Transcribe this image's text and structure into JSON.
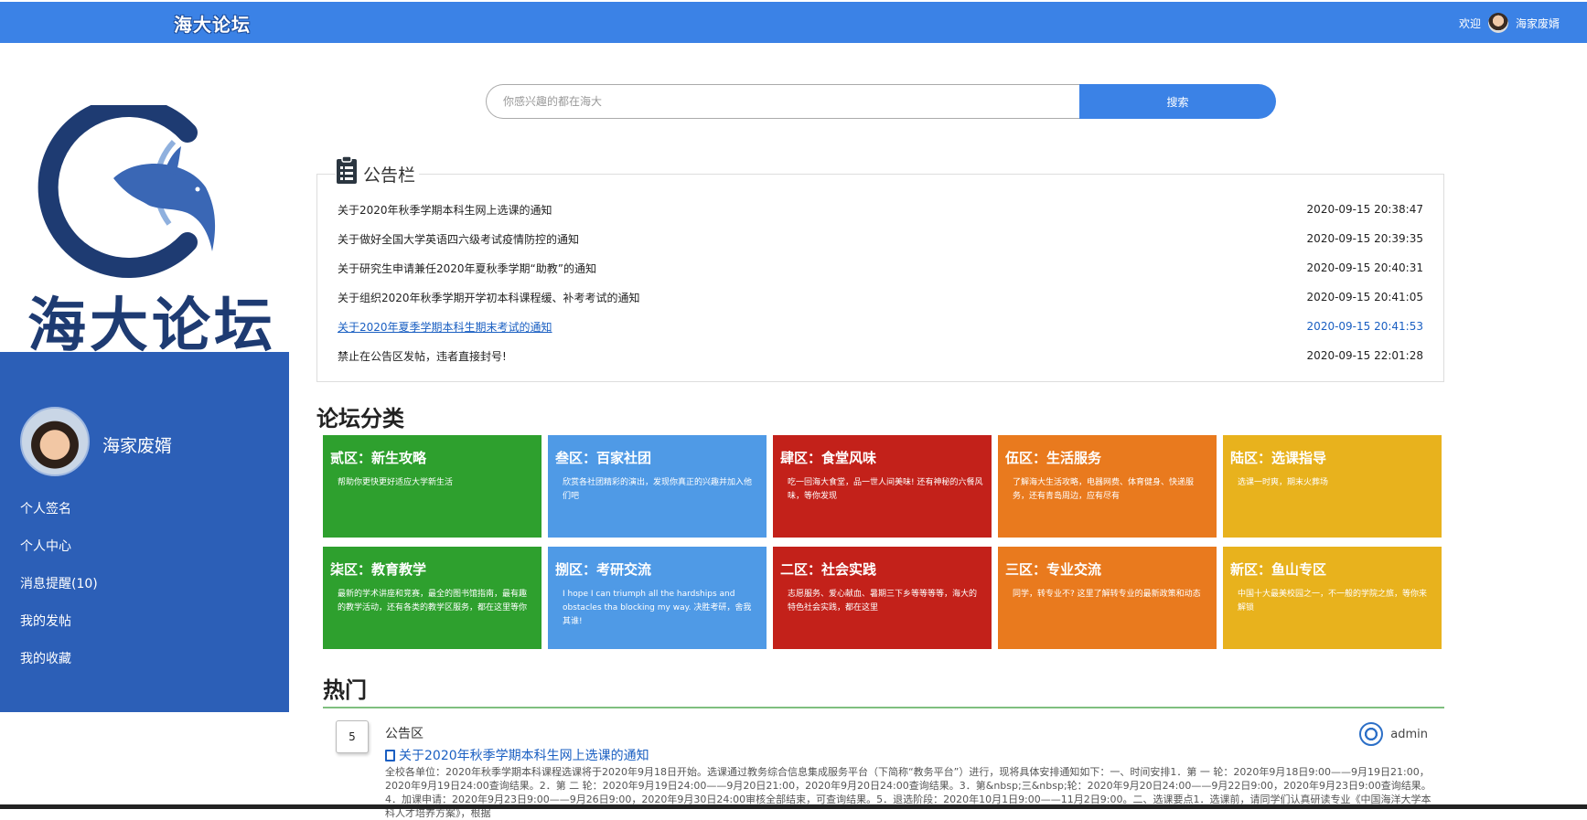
{
  "topbar": {
    "brand": "海大论坛",
    "welcome": "欢迎",
    "username": "海家废婿"
  },
  "logo": {
    "text": "海大论坛"
  },
  "sidebar": {
    "username": "海家废婿",
    "menu": [
      {
        "label": "个人签名"
      },
      {
        "label": "个人中心"
      },
      {
        "label": "消息提醒(10)"
      },
      {
        "label": "我的发帖"
      },
      {
        "label": "我的收藏"
      }
    ]
  },
  "search": {
    "placeholder": "你感兴趣的都在海大",
    "button": "搜索"
  },
  "notice": {
    "title": "公告栏",
    "items": [
      {
        "title": "关于2020年秋季学期本科生网上选课的通知",
        "time": "2020-09-15 20:38:47"
      },
      {
        "title": "关于做好全国大学英语四六级考试疫情防控的通知",
        "time": "2020-09-15 20:39:35"
      },
      {
        "title": "关于研究生申请兼任2020年夏秋季学期“助教”的通知",
        "time": "2020-09-15 20:40:31"
      },
      {
        "title": "关于组织2020年秋季学期开学初本科课程缓、补考考试的通知",
        "time": "2020-09-15 20:41:05"
      },
      {
        "title": "关于2020年夏季学期本科生期末考试的通知",
        "time": "2020-09-15 20:41:53"
      },
      {
        "title": "禁止在公告区发帖，违者直接封号!",
        "time": "2020-09-15 22:01:28"
      }
    ]
  },
  "categories": {
    "heading": "论坛分类",
    "tiles": [
      {
        "name": "贰区：新生攻略",
        "desc": "帮助你更快更好适应大学新生活",
        "color": "#2ea02e"
      },
      {
        "name": "叁区：百家社团",
        "desc": "欣赏各社团精彩的演出，发现你真正的兴趣并加入他们吧",
        "color": "#4f9ae6"
      },
      {
        "name": "肆区：食堂风味",
        "desc": "吃一回海大食堂，品一世人间美味! 还有神秘的六餐风味，等你发现",
        "color": "#c3211a"
      },
      {
        "name": "伍区：生活服务",
        "desc": "了解海大生活攻略，电器网费、体育健身、快递服务，还有青岛周边，应有尽有",
        "color": "#e97a1e"
      },
      {
        "name": "陆区：选课指导",
        "desc": "选课一时爽，期末火葬场",
        "color": "#e8b21d"
      },
      {
        "name": "柒区：教育教学",
        "desc": "最新的学术讲座和竞赛，最全的图书馆指南，最有趣的教学活动，还有各类的教学区服务，都在这里等你",
        "color": "#2ea02e"
      },
      {
        "name": "捌区：考研交流",
        "desc": "I hope I can triumph all the hardships and obstacles tha blocking my way. 决胜考研，舍我其谁!",
        "color": "#4f9ae6"
      },
      {
        "name": "二区：社会实践",
        "desc": "志愿服务、爱心献血、暑期三下乡等等等等，海大的特色社会实践，都在这里",
        "color": "#c3211a"
      },
      {
        "name": "三区：专业交流",
        "desc": "同学，转专业不? 这里了解转专业的最新政策和动态",
        "color": "#e97a1e"
      },
      {
        "name": "新区：鱼山专区",
        "desc": "中国十大最美校园之一，不一般的学院之旅，等你来解锁",
        "color": "#e8b21d"
      }
    ]
  },
  "hot": {
    "heading": "热门",
    "items": [
      {
        "count": "5",
        "board": "公告区",
        "author": "admin",
        "title": "关于2020年秋季学期本科生网上选课的通知",
        "excerpt": "全校各单位：2020年秋季学期本科课程选课将于2020年9月18日开始。选课通过教务综合信息集成服务平台（下简称“教务平台”）进行，现将具体安排通知如下：一、时间安排1．第 一 轮：2020年9月18日9:00——9月19日21:00，2020年9月19日24:00查询结果。2．第 二 轮：2020年9月19日24:00——9月20日21:00，2020年9月20日24:00查询结果。3．第&nbsp;三&nbsp;轮：2020年9月20日24:00——9月22日9:00，2020年9月23日9:00查询结果。4．加课申请：2020年9月23日9:00——9月26日9:00，2020年9月30日24:00审核全部结束，可查询结果。5．退选阶段：2020年10月1日9:00——11月2日9:00。二、选课要点1．选课前，请同学们认真研读专业《中国海洋大学本科人才培养方案》，根据"
      }
    ]
  }
}
